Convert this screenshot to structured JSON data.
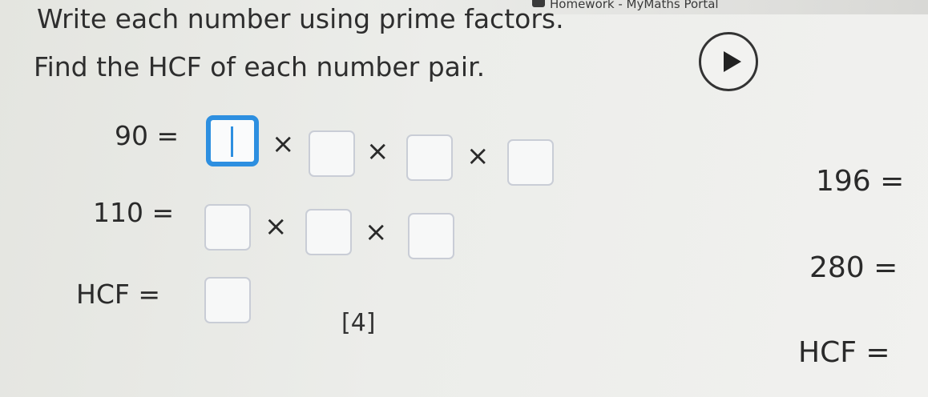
{
  "header": {
    "title": "Homework - MyMaths Portal"
  },
  "instructions": {
    "line1": "Write each number using prime factors.",
    "line2": "Find the HCF of each number pair."
  },
  "left_question": {
    "row1": {
      "label": "90 =",
      "operator": "×"
    },
    "row2": {
      "label": "110 =",
      "operator": "×"
    },
    "hcf": {
      "label": "HCF ="
    },
    "marks": "[4]"
  },
  "right_question": {
    "row1": {
      "label": "196 ="
    },
    "row2": {
      "label": "280 ="
    },
    "hcf": {
      "label": "HCF ="
    }
  },
  "colors": {
    "active_box_border": "#2d8fe0",
    "box_border": "#c9cdd6"
  },
  "icons": {
    "play": "play-icon",
    "header": "app-icon"
  }
}
